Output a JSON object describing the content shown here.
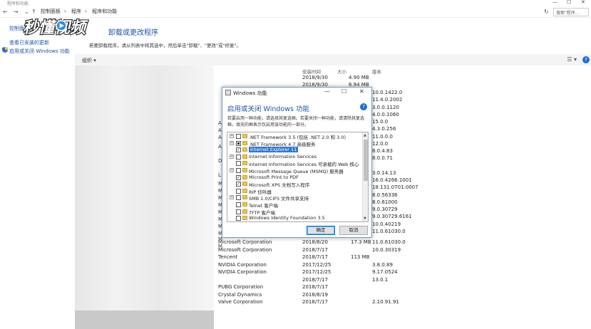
{
  "window": {
    "title": "程序和功能",
    "controls": [
      "—",
      "☐",
      "✕"
    ]
  },
  "nav": {
    "back": "←",
    "forward": "→",
    "down": "⌄",
    "up": "↑",
    "breadcrumb": [
      "控制面板",
      "程序",
      "程序和功能"
    ],
    "refresh": "↻",
    "search_placeholder": "搜索\"程序..."
  },
  "left": {
    "home": "控制面板主页",
    "updates": "查看已安装的更新",
    "features": "启用或关闭 Windows 功能"
  },
  "logo_text": "秒懂视频",
  "main": {
    "heading": "卸载或更改程序",
    "subtext": "若要卸载程序，请从列表中将其选中，然后单击\"卸载\"、\"更改\"或\"修复\"。",
    "organize": "组织 ▾",
    "help": "?"
  },
  "columns": {
    "installed": "安装时间",
    "size": "大小",
    "version": "版本"
  },
  "rows_upper": [
    {
      "date": "2018/9/30",
      "size": "4.90 MB",
      "version": ""
    },
    {
      "date": "2018/9/30",
      "size": "6.94 MB",
      "version": ""
    }
  ],
  "version_col": [
    "10.0.1422.0",
    "11.4.0.2002",
    "3.0.0.1120",
    "4.0.0.1060",
    "15.0.0",
    "4.3.0.256",
    "11.0.0.0",
    "12.0.0",
    "8.0.4.83",
    "8.0.0.71",
    "",
    "3.0.14.13",
    "16.0.4266.1001",
    "18.131.0701.0007",
    "8.0.56336",
    "8.0.61000",
    "9.0.30729",
    "9.0.30729.6161",
    "10.0.40219",
    "11.0.61030.0"
  ],
  "partial_letters": [
    "A",
    "A",
    "A",
    "A",
    "D",
    "L",
    "M",
    "M",
    "M",
    "M",
    "M",
    "M",
    "M",
    "M",
    "M",
    "M"
  ],
  "rows_lower": [
    {
      "publisher": "Microsoft Corporation",
      "date": "2018/8/20",
      "size": "17.3 MB",
      "version": "11.0.61030.0"
    },
    {
      "publisher": "Microsoft Corporation",
      "date": "2018/7/17",
      "size": "",
      "version": "10.0.30319"
    },
    {
      "publisher": "Tencent",
      "date": "2018/7/17",
      "size": "113 MB",
      "version": ""
    },
    {
      "publisher": "NVIDIA Corporation",
      "date": "2017/12/25",
      "size": "",
      "version": "3.8.0.89"
    },
    {
      "publisher": "NVIDIA Corporation",
      "date": "2017/12/25",
      "size": "",
      "version": "9.17.0524"
    },
    {
      "publisher": "",
      "date": "2018/7/17",
      "size": "",
      "version": "13.0.1"
    },
    {
      "publisher": "PUBG Corporation",
      "date": "2018/7/17",
      "size": "",
      "version": ""
    },
    {
      "publisher": "Crystal Dynamics",
      "date": "2018/8/19",
      "size": "",
      "version": ""
    },
    {
      "publisher": "Valve Corporation",
      "date": "2018/7/17",
      "size": "",
      "version": "2.10.91.91"
    }
  ],
  "dialog": {
    "title": "Windows 功能",
    "heading": "启用或关闭 Windows 功能",
    "help": "?",
    "description": "若要启用一种功能，请选择其复选框。若要关闭一种功能，请清除其复选框。填充的框表示仅启用该功能的一部分。",
    "items": [
      {
        "expand": "+",
        "state": "none",
        "label": ".NET Framework 3.5 (包括 .NET 2.0 和 3.0)"
      },
      {
        "expand": "+",
        "state": "partial",
        "label": ".NET Framework 4.7 高级服务"
      },
      {
        "expand": "",
        "state": "checked",
        "label": "Internet Explorer 11",
        "selected": true
      },
      {
        "expand": "+",
        "state": "none",
        "label": "Internet Information Services"
      },
      {
        "expand": "",
        "state": "none",
        "label": "Internet Information Services 可承载的 Web 核心"
      },
      {
        "expand": "+",
        "state": "none",
        "label": "Microsoft Message Queue (MSMQ) 服务器"
      },
      {
        "expand": "",
        "state": "checked",
        "label": "Microsoft Print to PDF"
      },
      {
        "expand": "",
        "state": "checked",
        "label": "Microsoft XPS 文档写入程序"
      },
      {
        "expand": "",
        "state": "none",
        "label": "RIP 侦听器"
      },
      {
        "expand": "+",
        "state": "none",
        "label": "SMB 1.0/CIFS 文件共享支持"
      },
      {
        "expand": "",
        "state": "none",
        "label": "Telnet 客户端"
      },
      {
        "expand": "",
        "state": "none",
        "label": "TFTP 客户端"
      },
      {
        "expand": "",
        "state": "none",
        "label": "Windows Identity Foundation 3.5"
      }
    ],
    "ok": "确定",
    "cancel": "取消"
  }
}
